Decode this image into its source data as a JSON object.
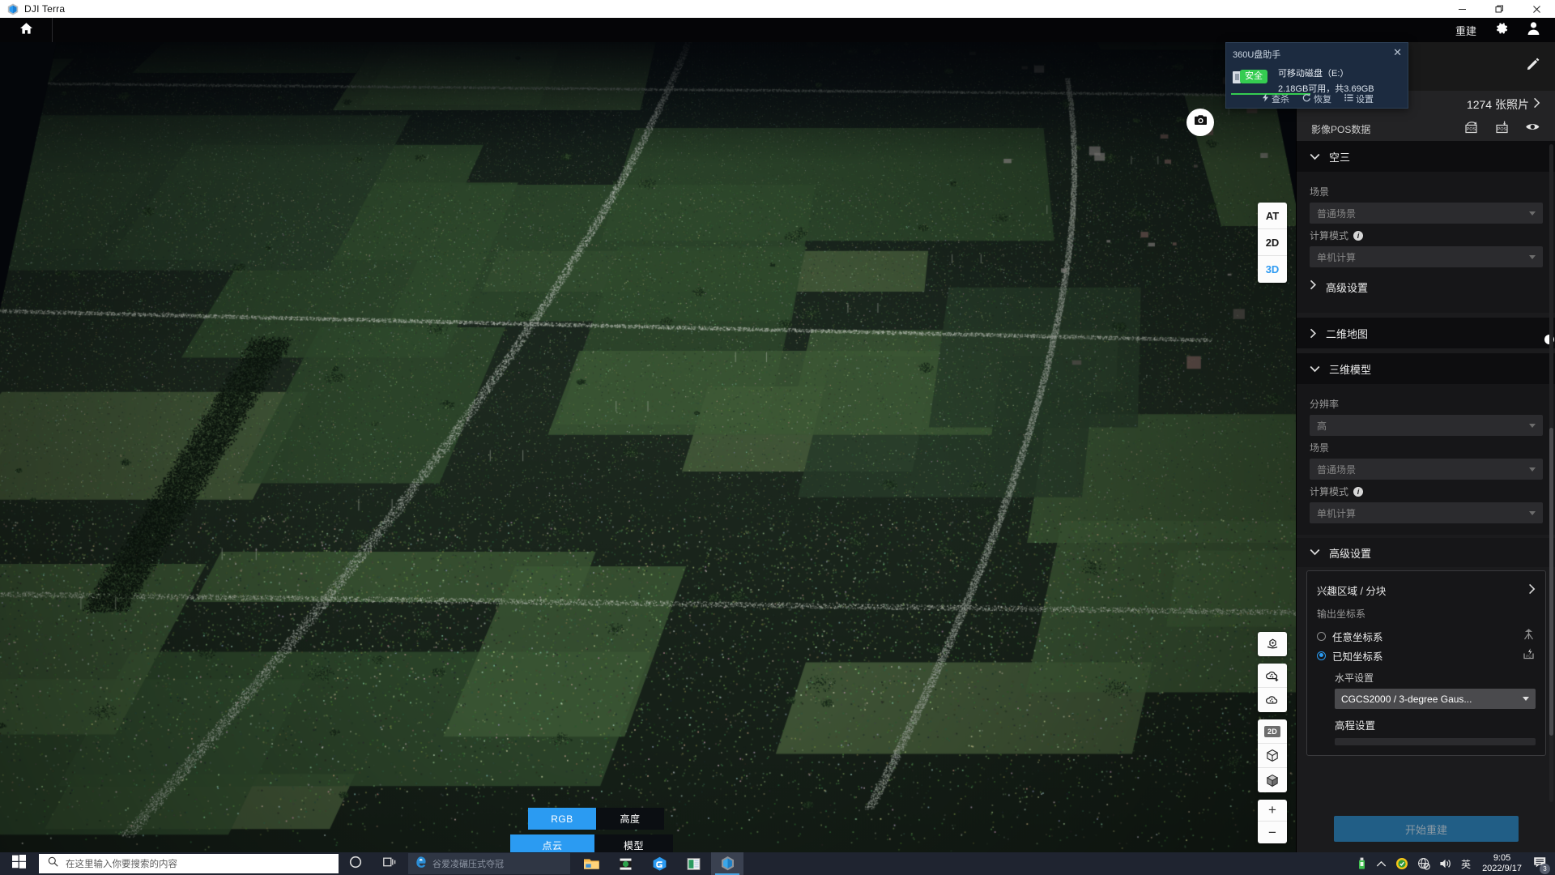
{
  "window": {
    "title": "DJI Terra",
    "minimize": "–",
    "maximize": "❐",
    "close": "✕"
  },
  "header": {
    "home_icon": "home-icon",
    "rebuild_label": "重建",
    "settings_icon": "gear-icon",
    "account_icon": "user-icon"
  },
  "viewport": {
    "snapshot_icon": "camera-icon",
    "view_modes": [
      {
        "label": "AT",
        "active": false
      },
      {
        "label": "2D",
        "active": false
      },
      {
        "label": "3D",
        "active": true
      }
    ],
    "tools": [
      {
        "name": "orbit-icon"
      },
      {
        "name": "point-cloud-add-icon"
      },
      {
        "name": "point-cloud-icon"
      },
      {
        "name": "2d-badge",
        "label": "2D"
      },
      {
        "name": "cube-outline-icon"
      },
      {
        "name": "cube-solid-icon"
      },
      {
        "name": "zoom-in-icon",
        "label": "+"
      },
      {
        "name": "zoom-out-icon",
        "label": "−"
      }
    ],
    "segments": {
      "row1": [
        {
          "label": "RGB",
          "active": true
        },
        {
          "label": "高度",
          "active": false
        }
      ],
      "row2": [
        {
          "label": "点云",
          "active": true
        },
        {
          "label": "模型",
          "active": false
        }
      ]
    }
  },
  "popup360": {
    "title": "360U盘助手",
    "close": "✕",
    "safe_badge": "安全",
    "drive": "可移动磁盘（E:）",
    "size": "2.18GB可用，共3.69GB",
    "actions": [
      {
        "icon": "bolt-icon",
        "label": "查杀"
      },
      {
        "icon": "restore-icon",
        "label": "恢复"
      },
      {
        "icon": "list-icon",
        "label": "设置"
      }
    ]
  },
  "panel": {
    "edit_icon": "pencil-icon",
    "photo_count": "1274 张照片",
    "photo_chevron": "›",
    "pos_label": "影像POS数据",
    "pos_icons": [
      "pos-export-icon",
      "pos-import-icon",
      "eye-icon"
    ],
    "sections": {
      "aerotriangulation": {
        "title": "空三",
        "expanded": true,
        "scene_label": "场景",
        "scene_value": "普通场景",
        "compute_label": "计算模式",
        "compute_value": "单机计算",
        "advanced_label": "高级设置"
      },
      "map2d": {
        "title": "二维地图",
        "enabled": false
      },
      "model3d": {
        "title": "三维模型",
        "enabled": true,
        "resolution_label": "分辨率",
        "resolution_value": "高",
        "scene_label": "场景",
        "scene_value": "普通场景",
        "compute_label": "计算模式",
        "compute_value": "单机计算"
      },
      "advanced": {
        "title": "高级设置",
        "roi_label": "兴趣区域 / 分块",
        "roi_chevron": "›",
        "output_cs_label": "输出坐标系",
        "option_arbitrary": "任意坐标系",
        "option_known": "已知坐标系",
        "selected": "known",
        "horizontal_label": "水平设置",
        "horizontal_value": "CGCS2000 / 3-degree Gaus...",
        "elevation_label": "高程设置"
      }
    },
    "start_button": "开始重建"
  },
  "taskbar": {
    "start_icon": "windows-icon",
    "search_placeholder": "在这里输入你要搜索的内容",
    "search_icon": "search-icon",
    "cortana_icon": "cortana-icon",
    "taskview_icon": "task-view-icon",
    "ie_label": "谷爱凌碾压式夺冠",
    "ie_icon": "internet-explorer-icon",
    "apps": [
      {
        "name": "file-explorer-icon"
      },
      {
        "name": "video-player-icon"
      },
      {
        "name": "gitee-icon"
      },
      {
        "name": "excel-icon"
      },
      {
        "name": "dji-terra-icon"
      }
    ],
    "tray": {
      "usb_icon": "usb-safe-remove-icon",
      "chevron_icon": "chevron-up-icon",
      "shield_icon": "360-shield-icon",
      "network_icon": "network-offline-icon",
      "volume_icon": "volume-icon",
      "ime_label": "英",
      "time": "9:05",
      "date": "2022/9/17",
      "notif_icon": "notification-icon",
      "notif_count": "3"
    }
  },
  "colors": {
    "accent": "#2b9bf2",
    "toggle_on": "#2b7fbd",
    "button": "#215e86",
    "panel_bg": "#1b1b1d",
    "safe_green": "#35cc51",
    "taskbar": "#1f2430"
  }
}
